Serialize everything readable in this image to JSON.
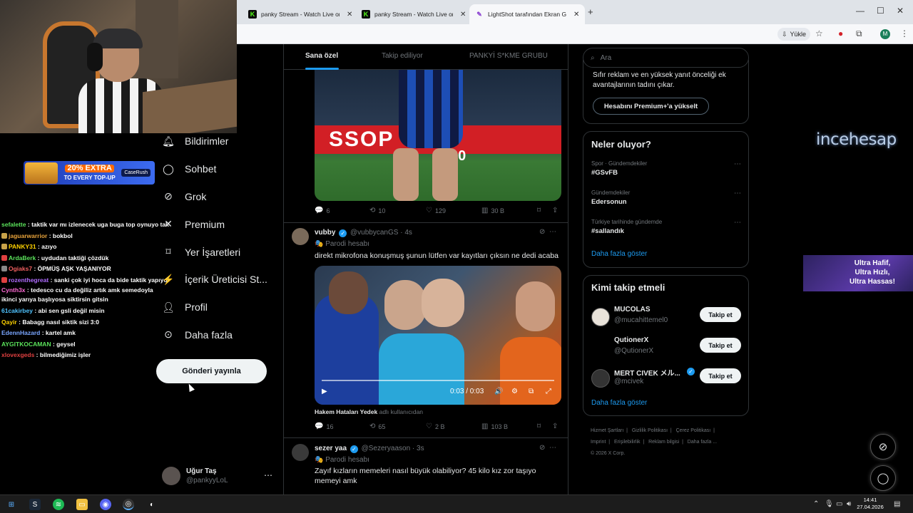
{
  "stream": {
    "ad_banner": {
      "big": "20% EXTRA",
      "small": "TO EVERY TOP-UP",
      "brand": "CaseRush"
    },
    "chat": [
      {
        "user": "sefalette",
        "text": "taktik var mı izlenecek uga buga top oynuyo takım",
        "color": "#5be35b",
        "badge": ""
      },
      {
        "user": "jaguarwarrior",
        "text": "bokbol",
        "color": "#e8a33b",
        "badge": "#c8a24a"
      },
      {
        "user": "PANKY31",
        "text": "azıyo",
        "color": "#ffd200",
        "badge": "#c8a24a"
      },
      {
        "user": "ArdaBerk",
        "text": "uydudan taktiği çözdük",
        "color": "#5be35b",
        "badge": "#e04040"
      },
      {
        "user": "Ogiaks7",
        "text": "ÖPMÜŞ AŞK YAŞANIYOR",
        "color": "#f06060",
        "badge": "#888888"
      },
      {
        "user": "rozenthegreat",
        "text": "sanki çok iyi hoca da bide taktik yapıyo",
        "color": "#b06cff",
        "badge": "#e04040"
      },
      {
        "user": "Cynth3x",
        "text": "tedesco cu da değiliz artık amk semedoyla ikinci yarıya başlıyosa siktirsin gitsin",
        "color": "#ff6ad5",
        "badge": ""
      },
      {
        "user": "61cakirbey",
        "text": "abi sen gsli değil misin",
        "color": "#4fc3ff",
        "badge": ""
      },
      {
        "user": "Qayir",
        "text": "Babagg nasıl siktik sizi 3:0",
        "color": "#ffd200",
        "badge": ""
      },
      {
        "user": "EdennHazard",
        "text": "kartel amk",
        "color": "#7aa6ff",
        "badge": ""
      },
      {
        "user": "AYGITKOCAMAN",
        "text": "geysel",
        "color": "#5be35b",
        "badge": ""
      },
      {
        "user": "xlovexgeds",
        "text": "bilmediğimiz işler",
        "color": "#e04040",
        "badge": ""
      }
    ],
    "incehesap": "incehesap",
    "promo": [
      "Ultra Hafif,",
      "Ultra Hızlı,",
      "Ultra Hassas!"
    ]
  },
  "browser": {
    "tabs": [
      {
        "title": "panky Stream - Watch Live on Kick",
        "icon": "kick-icon"
      },
      {
        "title": "panky Stream - Watch Live on Kick",
        "icon": "kick-icon"
      },
      {
        "title": "LightShot tarafından Ekran Görüntüsü",
        "icon": "lightshot-icon"
      }
    ],
    "toolbar": {
      "yukle": "Yükle",
      "avatar": "M"
    }
  },
  "nav": {
    "items": [
      {
        "label": "Bildirimler",
        "icon": "bell-icon"
      },
      {
        "label": "Sohbet",
        "icon": "chat-icon"
      },
      {
        "label": "Grok",
        "icon": "grok-icon"
      },
      {
        "label": "Premium",
        "icon": "premium-icon"
      },
      {
        "label": "Yer İşaretleri",
        "icon": "bookmark-icon"
      },
      {
        "label": "İçerik Üreticisi St...",
        "icon": "creator-studio-icon"
      },
      {
        "label": "Profil",
        "icon": "profile-icon"
      },
      {
        "label": "Daha fazla",
        "icon": "more-icon"
      }
    ],
    "post_button": "Gönderi yayınla",
    "profile": {
      "name": "Uğur Taş",
      "handle": "@pankyyLoL"
    }
  },
  "timeline": {
    "tabs": [
      "Sana özel",
      "Takip ediliyor",
      "PANKYİ S*KME GRUBU"
    ],
    "post1_stats": {
      "replies": "6",
      "reposts": "10",
      "likes": "129",
      "views": "30 B"
    },
    "media1": {
      "board": "SSOP",
      "number": "20"
    },
    "post2": {
      "name": "vubby",
      "handle": "@vubbycanGS",
      "time": "· 4s",
      "parody": "Parodi hesabı",
      "text": "direkt mikrofona konuşmuş şunun lütfen var kayıtları çıksın ne dedi acaba",
      "video_time": "0:03 / 0:03",
      "tagged_name": "Hakem Hataları Yedek",
      "tagged_suffix": "adlı kullanıcıdan",
      "stats": {
        "replies": "16",
        "reposts": "65",
        "likes": "2 B",
        "views": "103 B"
      }
    },
    "post3": {
      "name": "sezer yaa",
      "handle": "@Sezeryaason",
      "time": "· 3s",
      "parody": "Parodi hesabı",
      "text": "Zayıf kızların memeleri nasıl büyük olabiliyor? 45 kilo kız zor taşıyo memeyi amk"
    }
  },
  "sidebar": {
    "search_placeholder": "Ara",
    "premium": {
      "text": "Sıfır reklam ve en yüksek yanıt önceliği ek avantajlarının tadını çıkar.",
      "button": "Hesabını Premium+'a yükselt"
    },
    "trends_title": "Neler oluyor?",
    "trends": [
      {
        "category": "Spor · Gündemdekiler",
        "title": "#GSvFB"
      },
      {
        "category": "Gündemdekiler",
        "title": "Edersonun"
      },
      {
        "category": "Türkiye tarihinde gündemde",
        "title": "#sallandık"
      }
    ],
    "show_more": "Daha fazla göster",
    "follow_title": "Kimi takip etmeli",
    "follow": [
      {
        "name": "MUCOLAS",
        "handle": "@mucahittemel0",
        "button": "Takip et",
        "verified": false
      },
      {
        "name": "QutionerX",
        "handle": "@QutionerX",
        "button": "Takip et",
        "verified": false
      },
      {
        "name": "MERT CIVEK メル...",
        "handle": "@mcivek",
        "button": "Takip et",
        "verified": true
      }
    ],
    "footer": [
      "Hizmet Şartları",
      "Gizlilik Politikası",
      "Çerez Politikası",
      "Imprint",
      "Erişilebilirlik",
      "Reklam bilgisi",
      "Daha fazla ...",
      "© 2026 X Corp."
    ]
  },
  "taskbar": {
    "time": "14:41",
    "date": "27.04.2026"
  }
}
